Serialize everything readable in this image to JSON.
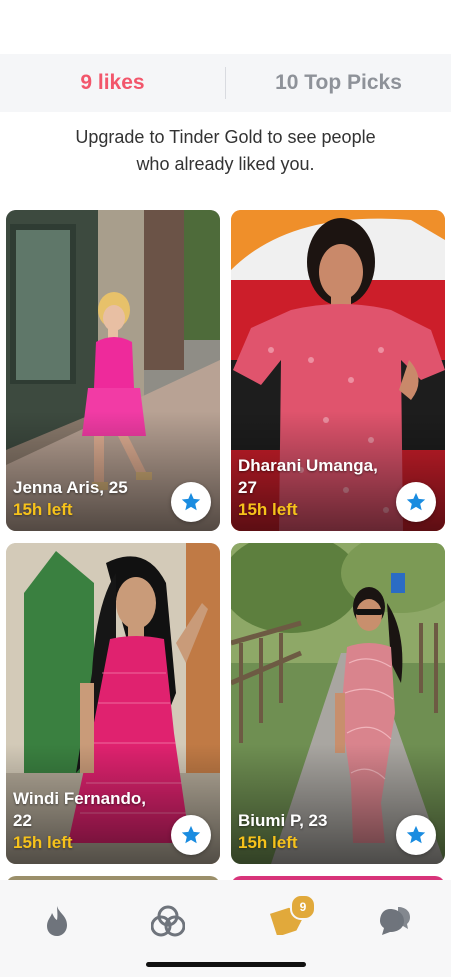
{
  "tabs": {
    "likes_label": "9 likes",
    "top_picks_label": "10 Top Picks"
  },
  "promo": {
    "line1": "Upgrade to Tinder Gold to see people",
    "line2": "who already liked you."
  },
  "cards": [
    {
      "name": "Jenna Aris, 25",
      "time": "15h left"
    },
    {
      "name": "Dharani Umanga, 27",
      "time": "15h left"
    },
    {
      "name": "Windi Fernando, 22",
      "time": "15h left"
    },
    {
      "name": "Biumi P, 23",
      "time": "15h left"
    }
  ],
  "nav": {
    "items": [
      "flame-icon",
      "explore-icon",
      "likes-icon",
      "chat-icon"
    ],
    "likes_badge": "9"
  },
  "colors": {
    "accent": "#f2566b",
    "gold": "#f6c21b",
    "star_blue": "#1a8ce0",
    "nav_icon": "#6f747c",
    "nav_active": "#e1a93b"
  }
}
